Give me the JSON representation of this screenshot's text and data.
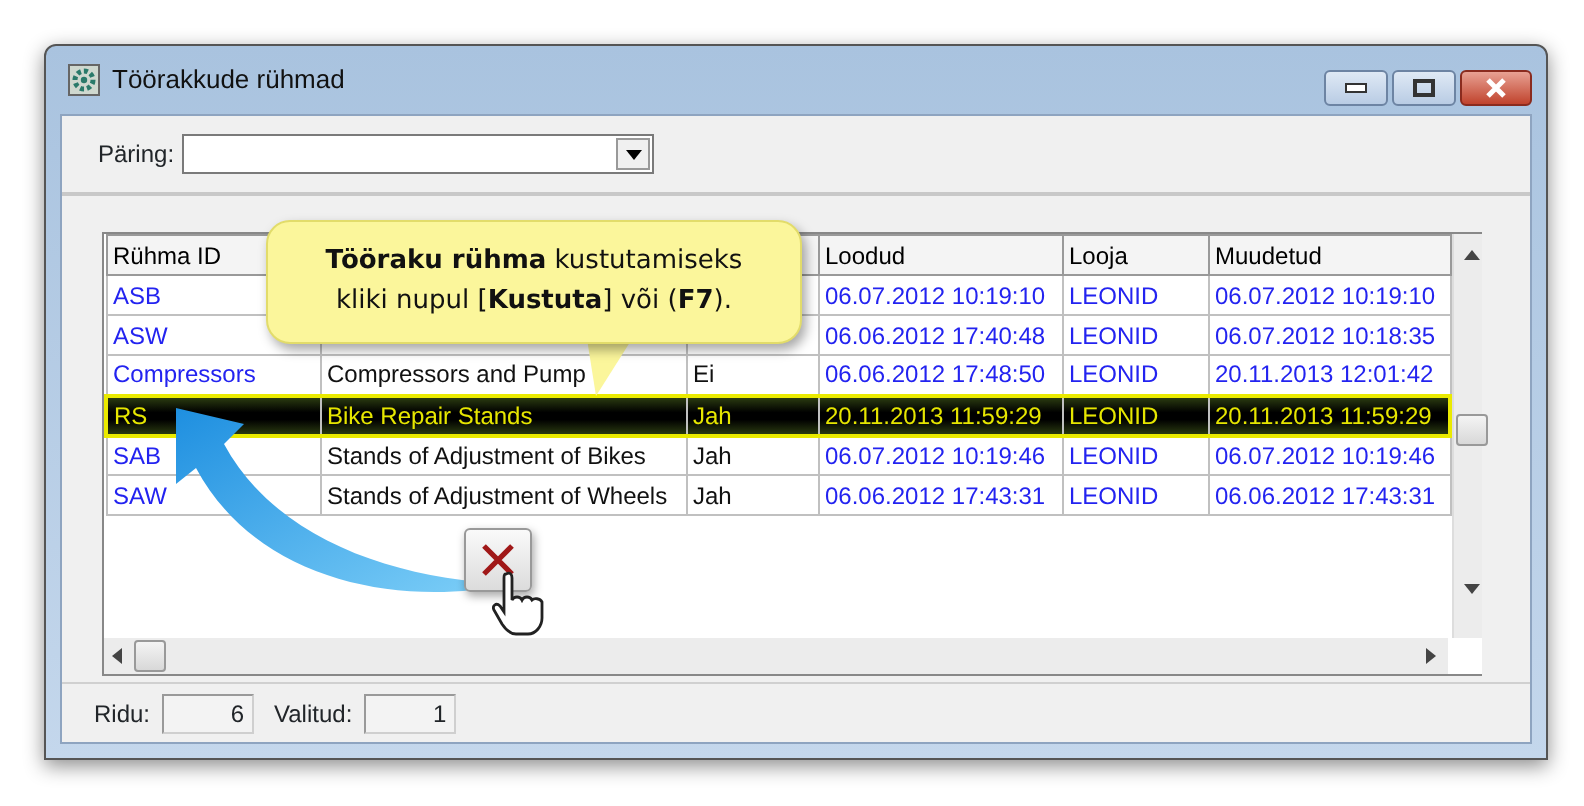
{
  "window": {
    "title": "Töörakkude rühmad"
  },
  "query": {
    "label": "Päring:"
  },
  "table": {
    "columns": [
      "Rühma ID",
      null,
      null,
      "Loodud",
      "Looja",
      "Muudetud"
    ],
    "rows": [
      {
        "cells": [
          "ASB",
          null,
          null,
          "06.07.2012 10:19:10",
          "LEONID",
          "06.07.2012 10:19:10"
        ],
        "selected": false
      },
      {
        "cells": [
          "ASW",
          null,
          null,
          "06.06.2012 17:40:48",
          "LEONID",
          "06.07.2012 10:18:35"
        ],
        "selected": false
      },
      {
        "cells": [
          "Compressors",
          "Compressors and Pump",
          "Ei",
          "06.06.2012 17:48:50",
          "LEONID",
          "20.11.2013 12:01:42"
        ],
        "selected": false
      },
      {
        "cells": [
          "RS",
          "Bike Repair Stands",
          "Jah",
          "20.11.2013 11:59:29",
          "LEONID",
          "20.11.2013 11:59:29"
        ],
        "selected": true
      },
      {
        "cells": [
          "SAB",
          "Stands of Adjustment of Bikes",
          "Jah",
          "06.07.2012 10:19:46",
          "LEONID",
          "06.07.2012 10:19:46"
        ],
        "selected": false
      },
      {
        "cells": [
          "SAW",
          "Stands of Adjustment of Wheels",
          "Jah",
          "06.06.2012 17:43:31",
          "LEONID",
          "06.06.2012 17:43:31"
        ],
        "selected": false
      }
    ]
  },
  "callout": {
    "lines": [
      "**Tööraku rühma** kustutamiseks",
      "kliki nupul [**Kustuta**] või (**F7**)."
    ]
  },
  "status_bar": [
    {
      "label": "Ridu:",
      "value": "6"
    },
    {
      "label": "Valitud:",
      "value": "1"
    }
  ]
}
